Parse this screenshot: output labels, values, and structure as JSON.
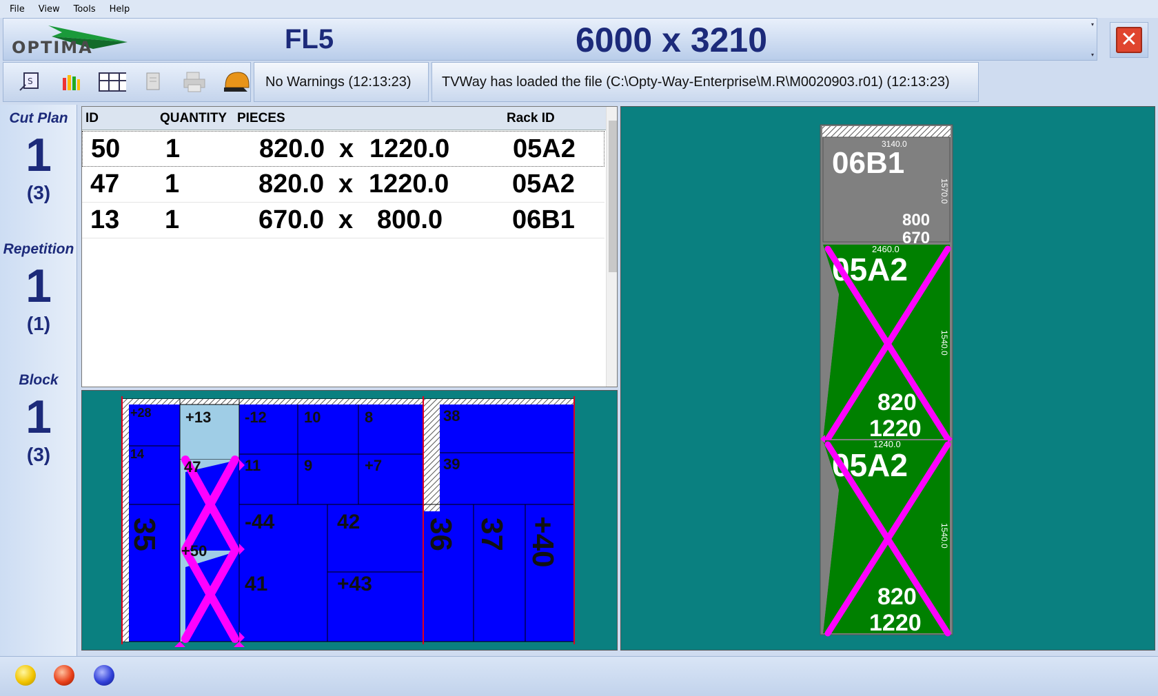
{
  "menu": [
    "File",
    "View",
    "Tools",
    "Help"
  ],
  "header": {
    "logo_text": "OPTIMA",
    "plant": "FL5",
    "dimensions": "6000 x 3210"
  },
  "icons": [
    "optimize-icon",
    "stats-icon",
    "layout-icon",
    "document-icon",
    "printer-icon",
    "helmet-icon"
  ],
  "status": {
    "warnings": "No Warnings (12:13:23)",
    "message": "TVWay has loaded the file (C:\\Opty-Way-Enterprise\\M.R\\M0020903.r01) (12:13:23)"
  },
  "left_panel": {
    "cut_plan_label": "Cut Plan",
    "cut_plan_value": "1",
    "cut_plan_total": "(3)",
    "repetition_label": "Repetition",
    "repetition_value": "1",
    "repetition_total": "(1)",
    "block_label": "Block",
    "block_value": "1",
    "block_total": "(3)"
  },
  "table": {
    "headers": {
      "id": "ID",
      "quantity": "QUANTITY",
      "pieces": "PIECES",
      "rack": "Rack ID"
    },
    "rows": [
      {
        "id": "50",
        "quantity": "1",
        "width": "820.0",
        "x": "x",
        "height": "1220.0",
        "rack": "05A2"
      },
      {
        "id": "47",
        "quantity": "1",
        "width": "820.0",
        "x": "x",
        "height": "1220.0",
        "rack": "05A2"
      },
      {
        "id": "13",
        "quantity": "1",
        "width": "670.0",
        "x": "x",
        "height": "800.0",
        "rack": "06B1"
      }
    ]
  },
  "plan": {
    "pieces": {
      "p28": "+28",
      "p13": "+13",
      "p12": "-12",
      "p10": "10",
      "p8": "8",
      "p38": "38",
      "p14": "14",
      "p47": "47",
      "p11": "11",
      "p9": "9",
      "p7": "+7",
      "p39": "39",
      "p35": "35",
      "p44": "-44",
      "p42": "42",
      "p36": "36",
      "p37": "37",
      "p40": "+40",
      "p50": "+50",
      "p41": "41",
      "p43": "+43"
    }
  },
  "rack": {
    "slot1": {
      "id": "06B1",
      "top": "3140.0",
      "side": "1570.0",
      "w": "800",
      "h": "670"
    },
    "slot2": {
      "id": "05A2",
      "top": "2460.0",
      "side": "1540.0",
      "w": "820",
      "h": "1220"
    },
    "slot3": {
      "id": "05A2",
      "top": "1240.0",
      "side": "1540.0",
      "w": "820",
      "h": "1220"
    }
  },
  "bottom_status": [
    "yellow",
    "red",
    "blue"
  ],
  "colors": {
    "accent": "#1c2a7a",
    "teal": "#0a8080",
    "piece_blue": "#0000ff",
    "highlight": "#ff00ff",
    "rack_green": "#008000"
  }
}
